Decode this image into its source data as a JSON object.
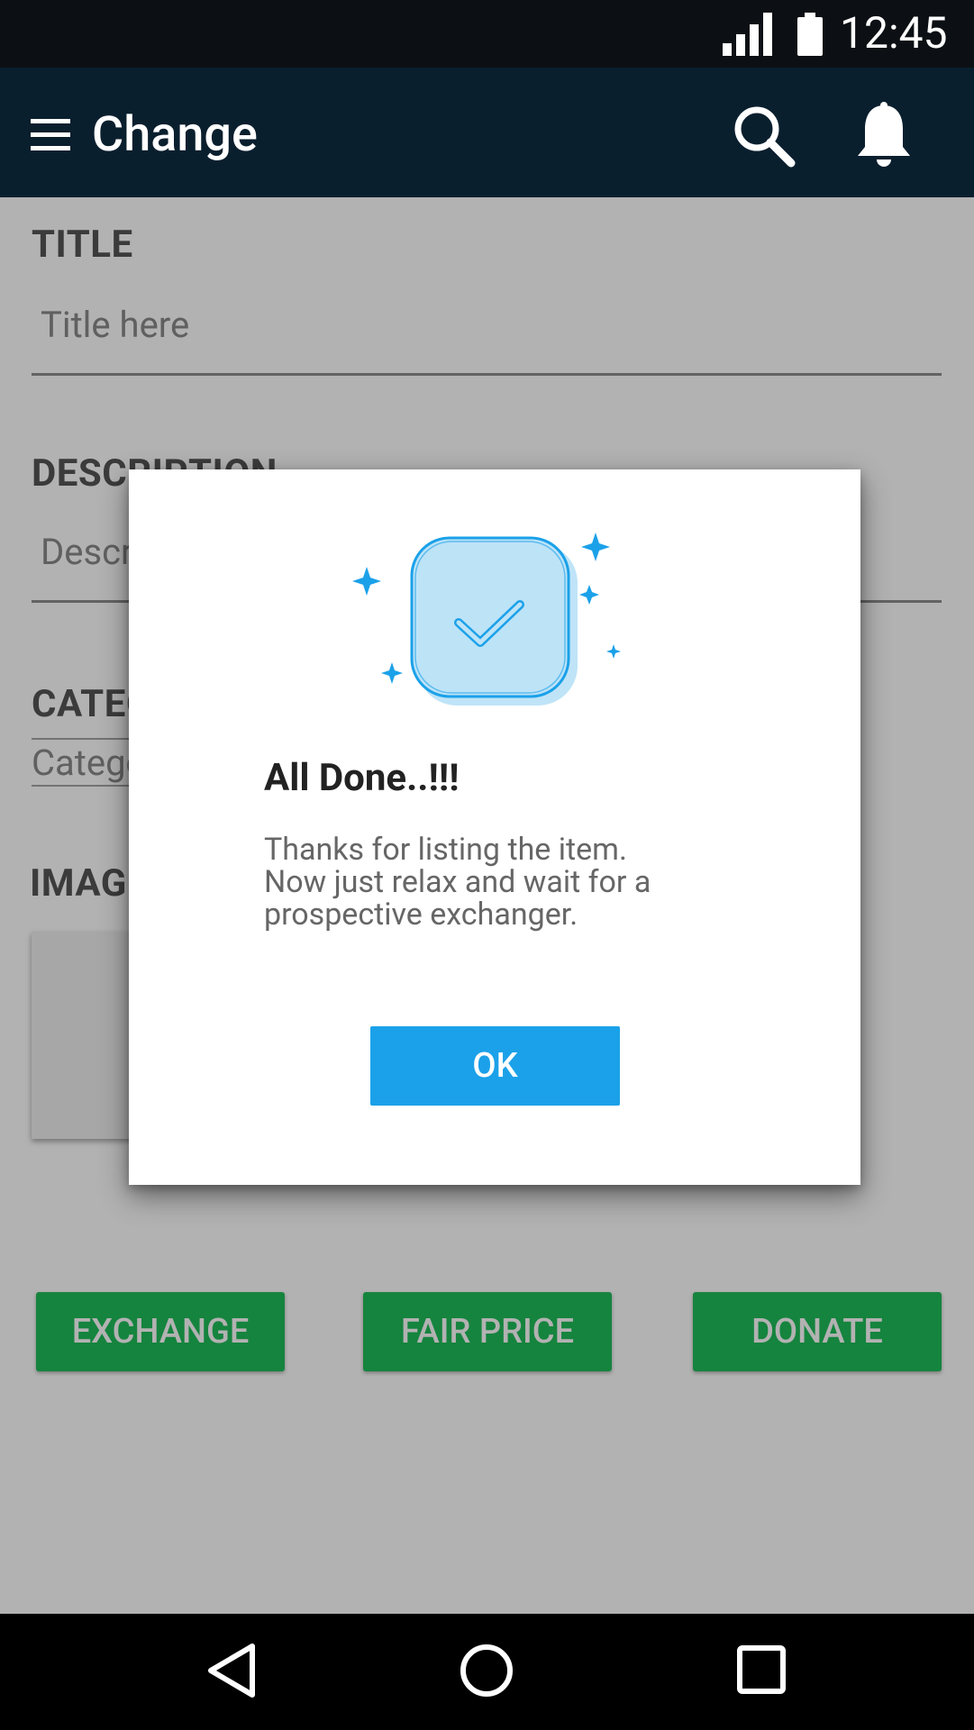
{
  "status_bar": {
    "time": "12:45",
    "icons": [
      "signal-icon",
      "battery-icon"
    ]
  },
  "app_bar": {
    "title": "Change",
    "icons": [
      "menu-icon",
      "search-icon",
      "bell-icon"
    ]
  },
  "form": {
    "title_label": "TITLE",
    "title_placeholder": "Title here",
    "description_label": "DESCRIPTION",
    "description_placeholder": "Description here",
    "category_label": "CATEGORY",
    "category_value": "Category",
    "images_label": "IMAGES"
  },
  "actions": {
    "exchange_label": "EXCHANGE",
    "fair_price_label": "FAIR PRICE",
    "donate_label": "DONATE"
  },
  "dialog": {
    "title": "All Done..!!!",
    "message": "Thanks for listing the item.\nNow just relax and wait for a\nprospective exchanger.",
    "ok_label": "OK"
  },
  "nav_bar": {
    "icons": [
      "back-icon",
      "home-icon",
      "recent-apps-icon"
    ]
  },
  "colors": {
    "app_bar": "#0a1f2e",
    "status_bar": "#0c1014",
    "action_green": "#1fbe5a",
    "ok_blue": "#1ba1e9",
    "illustration_blue": "#1ba1e9"
  }
}
